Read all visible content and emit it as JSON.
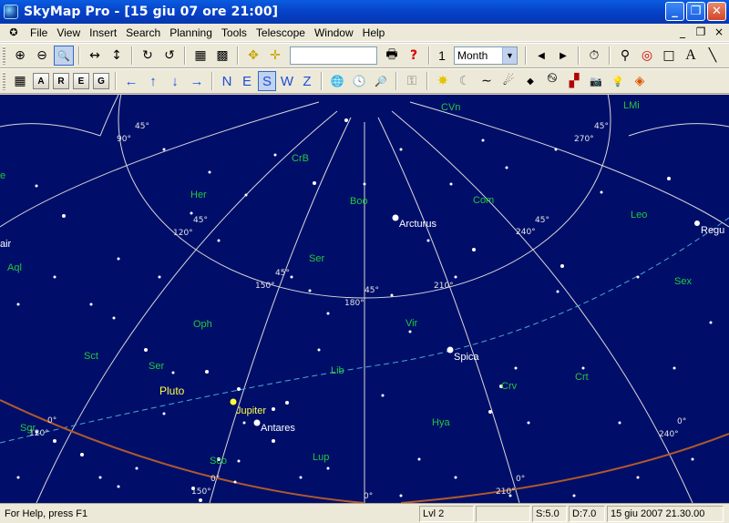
{
  "window": {
    "title": "SkyMap Pro - [15 giu 07 ore 21:00]",
    "min_glyph": "_",
    "restore_glyph": "❐",
    "close_glyph": "✕"
  },
  "menu": {
    "items": [
      "File",
      "View",
      "Insert",
      "Search",
      "Planning",
      "Tools",
      "Telescope",
      "Window",
      "Help"
    ],
    "mdi": [
      "_",
      "❐",
      "×"
    ]
  },
  "toolbar1": {
    "zoom_in": "⊕",
    "zoom_out": "⊖",
    "zoom_box": "🔍",
    "expand_h": "↔",
    "expand_v": "↕",
    "rotate_cw": "↻",
    "rotate_ccw": "↺",
    "grid_on": "▦",
    "grid_off": "▩",
    "center_object": "✥",
    "center_cross": "✛",
    "search_text": "",
    "print": "🖶",
    "help": "?",
    "step_value": "1",
    "step_unit": "Month",
    "prev": "◀",
    "next": "▶",
    "timer": "⏱",
    "telescope": "⚲",
    "target": "◎",
    "rect": "□",
    "text_tool": "A",
    "line_tool": "╲"
  },
  "toolbar2": {
    "grid_btn": "▦",
    "letters": [
      "A",
      "R",
      "E",
      "G"
    ],
    "arrows": [
      "←",
      "↑",
      "↓",
      "→"
    ],
    "directions": [
      "N",
      "E",
      "S",
      "W",
      "Z"
    ],
    "globe": "🌐",
    "clock": "🕓",
    "find": "🔎",
    "key": "⚿",
    "sun": "✸",
    "moon": "☾",
    "comet": "∼",
    "meteor": "☄",
    "asteroid": "◆",
    "galaxy": "࿊",
    "cluster": "▞",
    "camera": "📷",
    "bulb": "💡",
    "colors": "◈"
  },
  "sky": {
    "constellations": [
      {
        "name": "CVn"
      },
      {
        "name": "LMi"
      },
      {
        "name": "CrB"
      },
      {
        "name": "Her"
      },
      {
        "name": "Boo"
      },
      {
        "name": "Com"
      },
      {
        "name": "Leo"
      },
      {
        "name": "air"
      },
      {
        "name": "Aql"
      },
      {
        "name": "Ser"
      },
      {
        "name": "Sex"
      },
      {
        "name": "Oph"
      },
      {
        "name": "Vir"
      },
      {
        "name": "Sct"
      },
      {
        "name": "Ser"
      },
      {
        "name": "Lib"
      },
      {
        "name": "Crt"
      },
      {
        "name": "Crv"
      },
      {
        "name": "Sgr"
      },
      {
        "name": "Hya"
      },
      {
        "name": "Sco"
      },
      {
        "name": "Lup"
      },
      {
        "name": "e"
      }
    ],
    "stars": [
      {
        "name": "Arcturus"
      },
      {
        "name": "Spica"
      },
      {
        "name": "Antares"
      },
      {
        "name": "Regu"
      }
    ],
    "planets": [
      {
        "name": "Pluto"
      },
      {
        "name": "Jupiter"
      }
    ],
    "grid_labels": [
      "45°",
      "90°",
      "270°",
      "45°",
      "120°",
      "45°",
      "240°",
      "45°",
      "45°",
      "150°",
      "180°",
      "45°",
      "210°",
      "0°",
      "120°",
      "0°",
      "240°",
      "0°",
      "150°",
      "0°",
      "210°",
      "0°"
    ]
  },
  "status": {
    "help": "For Help, press F1",
    "level": "Lvl 2",
    "scale": "S:5.0",
    "depth": "D:7.0",
    "datetime": "15 giu 2007 21.30.00"
  }
}
